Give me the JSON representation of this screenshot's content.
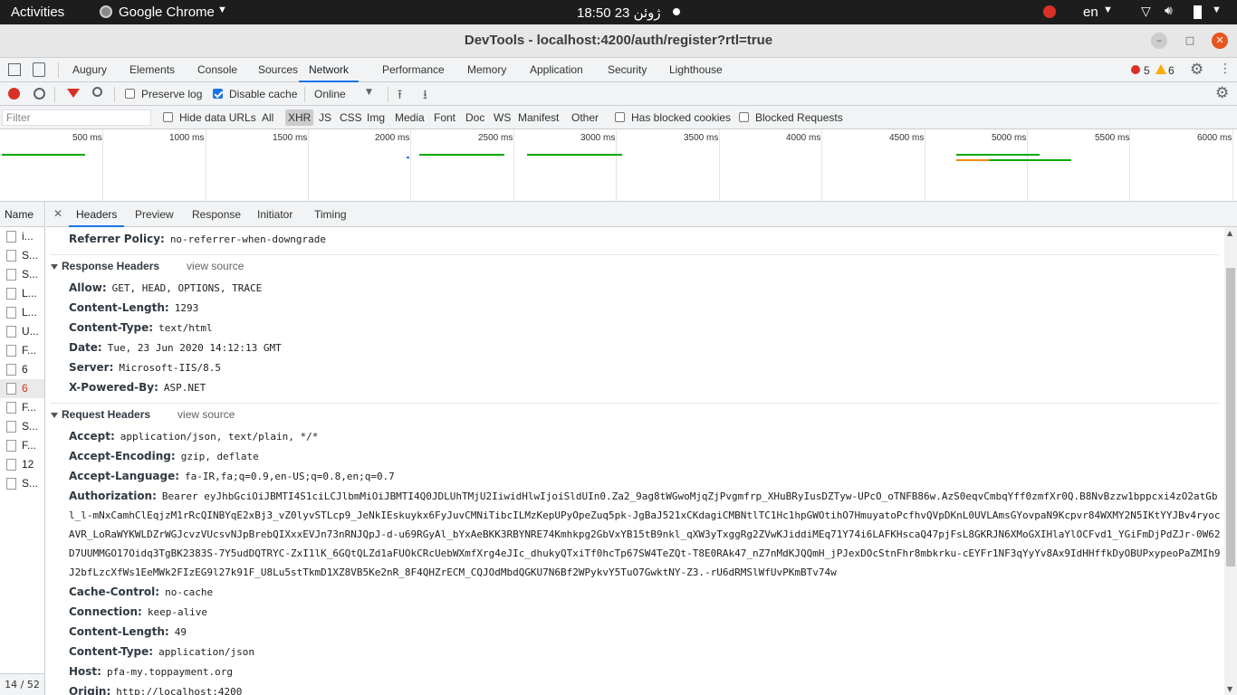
{
  "topbar": {
    "activities": "Activities",
    "app": "Google Chrome",
    "clock": "18:50  ژوئن 23",
    "lang": "en"
  },
  "window": {
    "title": "DevTools - localhost:4200/auth/register?rtl=true"
  },
  "devtools_tabs": [
    "Augury",
    "Elements",
    "Console",
    "Sources",
    "Network",
    "Performance",
    "Memory",
    "Application",
    "Security",
    "Lighthouse"
  ],
  "counts": {
    "errors": "5",
    "warnings": "6"
  },
  "toolbar": {
    "preserve_log": "Preserve log",
    "disable_cache": "Disable cache",
    "throttle": "Online"
  },
  "filter": {
    "placeholder": "Filter",
    "hide_data_urls": "Hide data URLs",
    "types": [
      "All",
      "XHR",
      "JS",
      "CSS",
      "Img",
      "Media",
      "Font",
      "Doc",
      "WS",
      "Manifest",
      "Other"
    ],
    "blocked_cookies": "Has blocked cookies",
    "blocked_requests": "Blocked Requests"
  },
  "timeline": {
    "ticks": [
      "500 ms",
      "1000 ms",
      "1500 ms",
      "2000 ms",
      "2500 ms",
      "3000 ms",
      "3500 ms",
      "4000 ms",
      "4500 ms",
      "5000 ms",
      "5500 ms",
      "6000 ms"
    ]
  },
  "names": {
    "header": "Name",
    "rows": [
      "i...",
      "S...",
      "S...",
      "L...",
      "L...",
      "U...",
      "F...",
      "6",
      "6",
      "F...",
      "S...",
      "F...",
      "12",
      "S..."
    ],
    "footer": "14 / 52"
  },
  "detail_tabs": [
    "Headers",
    "Preview",
    "Response",
    "Initiator",
    "Timing"
  ],
  "headers": {
    "referrer": {
      "k": "Referrer Policy:",
      "v": "no-referrer-when-downgrade"
    },
    "response_title": "Response Headers",
    "view_source": "view source",
    "response": [
      {
        "k": "Allow:",
        "v": "GET, HEAD, OPTIONS, TRACE"
      },
      {
        "k": "Content-Length:",
        "v": "1293"
      },
      {
        "k": "Content-Type:",
        "v": "text/html"
      },
      {
        "k": "Date:",
        "v": "Tue, 23 Jun 2020 14:12:13 GMT"
      },
      {
        "k": "Server:",
        "v": "Microsoft-IIS/8.5"
      },
      {
        "k": "X-Powered-By:",
        "v": "ASP.NET"
      }
    ],
    "request_title": "Request Headers",
    "request_pre": [
      {
        "k": "Accept:",
        "v": "application/json, text/plain, */*"
      },
      {
        "k": "Accept-Encoding:",
        "v": "gzip, deflate"
      },
      {
        "k": "Accept-Language:",
        "v": "fa-IR,fa;q=0.9,en-US;q=0.8,en;q=0.7"
      }
    ],
    "auth_key": "Authorization:",
    "auth_val": "Bearer eyJhbGciOiJBMTI4S1ciLCJlbmMiOiJBMTI4Q0JDLUhTMjU2IiwidHlwIjoiSldUIn0.Za2_9ag8tWGwoMjqZjPvgmfrp_XHuBRyIusDZTyw-UPcO_oTNFB86w.AzS0eqvCmbqYff0zmfXr0Q.B8NvBzzw1bppcxi4zO2atGbl_l-mNxCamhClEqjzM1rRcQINBYqE2xBj3_vZ0lyvSTLcp9_JeNkIEskuykx6FyJuvCMNiTibcILMzKepUPyOpeZuq5pk-JgBaJ521xCKdagiCMBNtlTC1Hc1hpGWOtihO7HmuyatoPcfhvQVpDKnL0UVLAmsGYovpaN9Kcpvr84WXMY2N5IKtYYJBv4ryocAVR_LoRaWYKWLDZrWGJcvzVUcsvNJpBrebQIXxxEVJn73nRNJQpJ-d-u69RGyAl_bYxAeBKK3RBYNRE74Kmhkpg2GbVxYB15tB9nkl_qXW3yTxggRg2ZVwKJiddiMEq71Y74i6LAFKHscaQ47pjFsL8GKRJN6XMoGXIHlaYlOCFvd1_YGiFmDjPdZJr-0W62D7UUMMGO17Oidq3TgBK2383S-7Y5udDQTRYC-ZxI1lK_6GQtQLZd1aFUOkCRcUebWXmfXrg4eJIc_dhukyQTxiTf0hcTp67SW4TeZQt-T8E0RAk47_nZ7nMdKJQQmH_jPJexDOcStnFhr8mbkrku-cEYFr1NF3qYyYv8Ax9IdHHffkDyOBUPxypeoPaZMIh9J2bfLzcXfWs1EeMWk2FIzEG9l27k91F_U8Lu5stTkmD1XZ8VB5Ke2nR_8F4QHZrECM_CQJOdMbdQGKU7N6Bf2WPykvY5TuO7GwktNY-Z3.-rU6dRMSlWfUvPKmBTv74w",
    "request_post": [
      {
        "k": "Cache-Control:",
        "v": "no-cache"
      },
      {
        "k": "Connection:",
        "v": "keep-alive"
      },
      {
        "k": "Content-Length:",
        "v": "49"
      },
      {
        "k": "Content-Type:",
        "v": "application/json"
      },
      {
        "k": "Host:",
        "v": "pfa-my.toppayment.org"
      },
      {
        "k": "Origin:",
        "v": "http://localhost:4200"
      }
    ]
  },
  "colors": {
    "accent": "#1a73e8",
    "error": "#d93025",
    "warning": "#f9ab00",
    "record": "#d93025",
    "bar_green": "#0a0",
    "bar_orange": "#f08c00"
  }
}
